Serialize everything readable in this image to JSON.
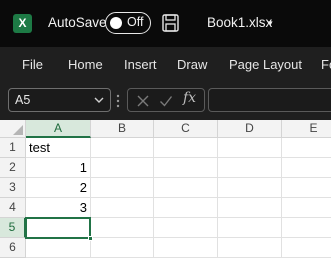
{
  "titlebar": {
    "app_icon_letter": "X",
    "autosave_label": "AutoSave",
    "autosave_state": "Off",
    "file_name": "Book1.xlsx",
    "caret": "▾"
  },
  "ribbon": {
    "tabs": [
      "File",
      "Home",
      "Insert",
      "Draw",
      "Page Layout",
      "Fo"
    ]
  },
  "formula_bar": {
    "name_box": "A5",
    "fx_label": "fx",
    "formula_value": ""
  },
  "sheet": {
    "columns": [
      "A",
      "B",
      "C",
      "D",
      "E"
    ],
    "rows": [
      "1",
      "2",
      "3",
      "4",
      "5",
      "6"
    ],
    "cells": {
      "A1": "test",
      "A2": "1",
      "A3": "2",
      "A4": "3"
    },
    "active_cell": "A5"
  },
  "colors": {
    "accent": "#217346",
    "title_bg": "#0a0a0a",
    "ribbon_bg": "#1f1f1f"
  }
}
